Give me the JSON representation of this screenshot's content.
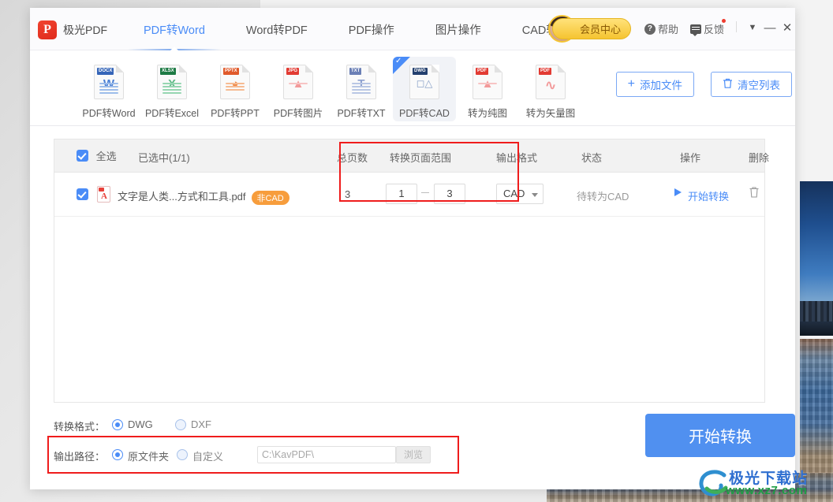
{
  "window": {
    "brand": "极光PDF",
    "logo_letter": "P",
    "nav": [
      {
        "label": "PDF转Word",
        "active": true
      },
      {
        "label": "Word转PDF",
        "active": false
      },
      {
        "label": "PDF操作",
        "active": false
      },
      {
        "label": "图片操作",
        "active": false
      },
      {
        "label": "CAD转换",
        "active": false
      }
    ],
    "vip_label": "会员中心",
    "help_label": "帮助",
    "feedback_label": "反馈",
    "collapse_icon": "▼",
    "minimize_icon": "—",
    "close_icon": "✕"
  },
  "tools": [
    {
      "label": "PDF转Word",
      "tag": "DOCX",
      "tag_color": "#3565b8",
      "glyph": "W",
      "glyph_color": "#4a7fd4",
      "line_color": "#9dbdea",
      "selected": false
    },
    {
      "label": "PDF转Excel",
      "tag": "XLSX",
      "tag_color": "#1d7a44",
      "glyph": "X",
      "glyph_color": "#5fba86",
      "line_color": "#96d6b1",
      "selected": false
    },
    {
      "label": "PDF转PPT",
      "tag": "PPTX",
      "tag_color": "#e05a2b",
      "glyph": "◕",
      "glyph_color": "#f08c4e",
      "line_color": "#f6bb92",
      "selected": false
    },
    {
      "label": "PDF转图片",
      "tag": "JPG",
      "tag_color": "#e23b33",
      "glyph": "▲",
      "glyph_color": "#f29a9a",
      "line_color": "#f7c4c4",
      "selected": false
    },
    {
      "label": "PDF转TXT",
      "tag": "TXT",
      "tag_color": "#6a7fb5",
      "glyph": "T",
      "glyph_color": "#8da0cf",
      "line_color": "#b9c7e4",
      "selected": false
    },
    {
      "label": "PDF转CAD",
      "tag": "DWG",
      "tag_color": "#24406e",
      "glyph": "◻",
      "glyph_color": "#8fa6ca",
      "line_color": "#c2cee0",
      "selected": true
    },
    {
      "label": "转为纯图",
      "tag": "PDF",
      "tag_color": "#e23b33",
      "glyph": "▲",
      "glyph_color": "#f29a9a",
      "line_color": "#f7c4c4",
      "selected": false
    },
    {
      "label": "转为矢量图",
      "tag": "PDF",
      "tag_color": "#e23b33",
      "glyph": "∿",
      "glyph_color": "#f29a9a",
      "line_color": "#f7c4c4",
      "selected": false
    }
  ],
  "toolbar": {
    "add_file_label": "添加文件",
    "add_file_icon": "+",
    "clear_list_label": "清空列表",
    "clear_list_icon": "trash-icon"
  },
  "list": {
    "header": {
      "select_all": "全选",
      "selected_count": "已选中(1/1)",
      "total_pages": "总页数",
      "page_range": "转换页面范围",
      "output_format": "输出格式",
      "status": "状态",
      "action": "操作",
      "delete": "删除"
    },
    "rows": [
      {
        "filename": "文字是人类...方式和工具.pdf",
        "badge": "非CAD",
        "total_pages": "3",
        "range_from": "1",
        "range_to": "3",
        "format": "CAD",
        "status": "待转为CAD",
        "action": "开始转换"
      }
    ]
  },
  "footer": {
    "format_label": "转换格式：",
    "format_options": [
      {
        "label": "DWG",
        "selected": true
      },
      {
        "label": "DXF",
        "selected": false
      }
    ],
    "path_label": "输出路径：",
    "path_options": [
      {
        "label": "原文件夹",
        "selected": true
      },
      {
        "label": "自定义",
        "selected": false
      }
    ],
    "path_value": "C:\\KavPDF\\",
    "browse_label": "浏览",
    "convert_label": "开始转换"
  },
  "watermark": {
    "title": "极光下载站",
    "url": "www.xz7.com"
  },
  "colors": {
    "accent": "#4a8cf7",
    "annotation": "#ef1c1c",
    "badge": "#f79d3c",
    "vip": "#f5c431"
  }
}
